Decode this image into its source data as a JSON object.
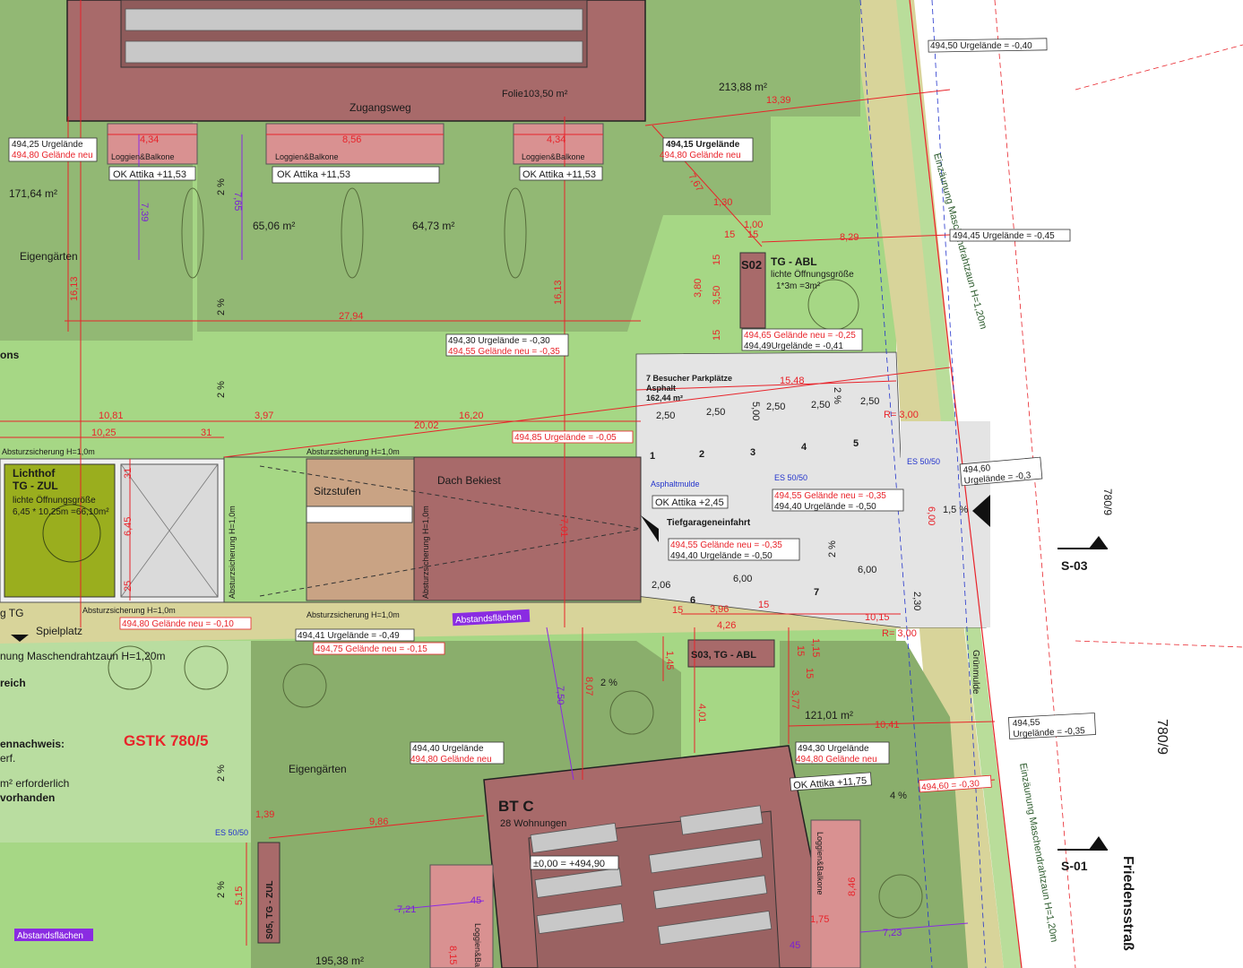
{
  "labels": {
    "gstk": "GSTK 780/5",
    "bt_c": "BT C",
    "bt_c_units": "28 Wohnungen",
    "zugangsweg": "Zugangsweg",
    "folie": "Folie103,50 m²",
    "eigengarten_1": "Eigengärten",
    "eigengarten_2": "Eigengärten",
    "spielplatz": "Spielplatz",
    "dach_bekiest": "Dach Bekiest",
    "sitzstufen": "Sitzstufen",
    "lichthof_title": "Lichthof",
    "lichthof_sub": "TG - ZUL",
    "lichthof_note1": "lichte Öffnungsgröße",
    "lichthof_note2": "6,45 * 10,25m =66,10m²",
    "tg_abl_code": "S02",
    "tg_abl_title": "TG - ABL",
    "tg_abl_note1": "lichte Öffnungsgröße",
    "tg_abl_note2": "1*3m =3m²",
    "s03": "S03, TG - ABL",
    "s05": "S05, TG - ZUL",
    "parking_title": "7 Besucher Parkplätze",
    "parking_mat": "Asphalt",
    "parking_area": "162,44 m²",
    "asphaltmulde": "Asphaltmulde",
    "tg_einfahrt": "Tiefgarageneinfahrt",
    "gruenmulde": "Grünmulde",
    "friedensstr": "Friedensstraß",
    "lot_780_9a": "780/9",
    "lot_780_9b": "780/9",
    "section_s03": "S-03",
    "section_s01": "S-01",
    "zaun_1": "Einzäunung Maschendrahtzaun H=1,20m",
    "zaun_2": "Einzäunung Maschendrahtzaun H=1,20m",
    "zaun_3": "nung Maschendrahtzaun H=1,20m",
    "abstand_1": "Abstandsflächen",
    "abstand_2": "Abstandsflächen",
    "absturz_1": "Absturzsicherung H=1,0m",
    "absturz_2": "Absturzsicherung H=1,0m",
    "absturz_3": "Absturzsicherung H=1,0m",
    "absturz_4": "Absturzsicherung H=1,0m",
    "absturz_v1": "Absturzsicherung H=1,0m",
    "absturz_v2": "Absturzsicherung H=1,0m",
    "loggien_1": "Loggien&Balkone",
    "loggien_2": "Loggien&Balkone",
    "loggien_3": "Loggien&Balkone",
    "loggien_v": "Loggien&Balkone",
    "loggien_v2": "Loggien&Ba",
    "ons": "ons",
    "reich": "reich",
    "g_tg": "g TG",
    "left_1": "ennachweis:",
    "left_2": "erf.",
    "left_3": "m² erforderlich",
    "left_4": "vorhanden",
    "es_1": "ES 50/50",
    "es_2": "ES 50/50",
    "es_3": "ES 50/50",
    "zero_level": "±0,00 = +494,90"
  },
  "areas": {
    "a1": "213,88 m²",
    "a2": "171,64 m²",
    "a3": "65,06 m²",
    "a4": "64,73 m²",
    "a5": "121,01 m²",
    "a6": "195,38 m²"
  },
  "attika": {
    "a1": "OK Attika +11,53",
    "a2": "OK Attika +11,53",
    "a3": "OK Attika +11,53",
    "a4": "OK Attika +2,45",
    "a5": "OK Attika +11,75"
  },
  "levels": {
    "l1": "494,50 Urgelände = -0,40",
    "l2": "494,45 Urgelände = -0,45",
    "l3a": "494,25 Urgelände",
    "l3b": "494,80 Gelände neu",
    "l4a": "494,15 Urgelände",
    "l4b": "494,80 Gelände neu",
    "l5a": "494,30 Urgelände = -0,30",
    "l5b": "494,55 Gelände neu = -0,35",
    "l6a": "494,65 Gelände neu = -0,25",
    "l6b": "494,49Urgelände = -0,41",
    "l7": "494,85 Urgelände = -0,05",
    "l8a": "494,55 Gelände neu = -0,35",
    "l8b": "494,40 Urgelände = -0,50",
    "l9a": "494,55 Gelände neu = -0,35",
    "l9b": "494,40 Urgelände = -0,50",
    "l10a": "494,60",
    "l10b": "Urgelände = -0,3",
    "l11": "494,80 Gelände neu = -0,10",
    "l12a": "494,41 Urgelände = -0,49",
    "l12b": "494,75 Gelände neu = -0,15",
    "l13a": "494,40 Urgelände",
    "l13b": "494,80 Gelände neu",
    "l14a": "494,30 Urgelände",
    "l14b": "494,80 Gelände neu",
    "l15": "494,60 = -0,30",
    "l16a": "494,55",
    "l16b": "Urgelände = -0,35"
  },
  "dims": {
    "d1": "4,34",
    "d2": "8,56",
    "d3": "4,34",
    "d4": "13,39",
    "d5": "7,67",
    "d6": "1,30",
    "d7": "1,00",
    "d8": "8,29",
    "d9": "15",
    "d10": "15",
    "d11": "3,80",
    "d12": "3,50",
    "d13": "15",
    "d14": "15",
    "d15": "16,13",
    "d16": "16,13",
    "d17": "27,94",
    "d18": "7,39",
    "d19": "7,65",
    "d20": "10,81",
    "d21": "10,25",
    "d22": "3,97",
    "d23": "20,02",
    "d24": "16,20",
    "d25": "31",
    "d26": "15,48",
    "d27": "2,50",
    "d28": "2,50",
    "d29": "2,50",
    "d30": "2,50",
    "d31": "2,50",
    "d32": "5,00",
    "d33": "R= 3,00",
    "d34": "6,00",
    "d35": "6,00",
    "d36": "6,00",
    "d37": "2,06",
    "d38": "2,30",
    "d39": "3,96",
    "d40": "4,26",
    "d41": "15",
    "d42": "15",
    "d43": "10,15",
    "d44": "R= 3,00",
    "d45": "1,45",
    "d46": "8,07",
    "d47": "7,50",
    "d48": "4,01",
    "d49": "3,77",
    "d50": "1,15",
    "d51": "15",
    "d52": "15",
    "d53": "10,41",
    "d54": "7,01",
    "d55": "6,45",
    "d56": "31",
    "d57": "25",
    "d58": "9,86",
    "d59": "1,39",
    "d60": "5,15",
    "d61": "7,21",
    "d62": "45",
    "d63": "1,75",
    "d64": "45",
    "d65": "7,23",
    "d66": "8,46",
    "d67": "8,15"
  },
  "slopes": {
    "s1": "2 %",
    "s2": "2 %",
    "s3": "2 %",
    "s4": "2 %",
    "s5": "2 %",
    "s6": "2 %",
    "s7": "2 %",
    "s8": "2 %",
    "s9": "1,5 %",
    "s10": "4 %",
    "s11": "2 %"
  },
  "parking_numbers": [
    "1",
    "2",
    "3",
    "4",
    "5",
    "6",
    "7"
  ],
  "colors": {
    "grass": "#a6d785",
    "garden": "#92b874",
    "roof": "#a86a6a",
    "path": "#d8d49a",
    "asphalt": "#e4e4e4",
    "lichthof": "#9aae1e",
    "wood": "#c9a384",
    "dim_red": "#e8232a",
    "dim_purple": "#8a2be2"
  }
}
